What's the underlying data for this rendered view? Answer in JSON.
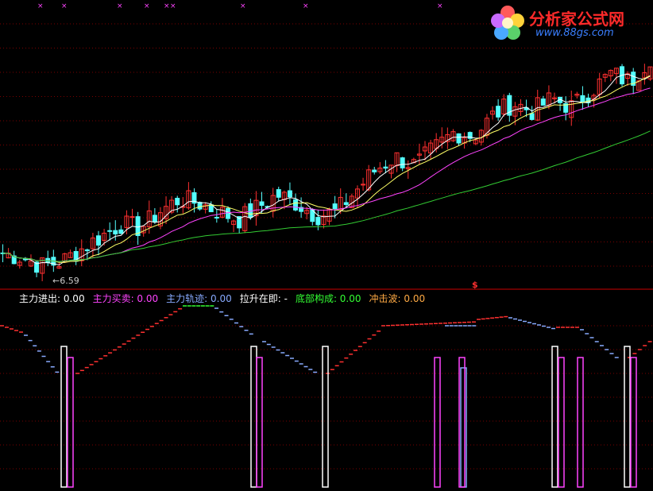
{
  "logo": {
    "title": "分析家公式网",
    "url": "www.88gs.com",
    "icon": "flower-logo-icon"
  },
  "colors": {
    "up": "#ff3030",
    "down": "#54ffff",
    "ma_fast": "#ffffff",
    "ma_mid": "#ffff66",
    "ma_slow": "#ff44ff",
    "ma_long": "#33cc33",
    "grid": "#7a0000",
    "divider": "#cc0000"
  },
  "price_panel": {
    "low_marker": "←6.59",
    "signal_mark": "$",
    "top_marks_icon": "x-mark-icon"
  },
  "legend": [
    {
      "label": "主力进出: 0.00",
      "color": "#ffffff"
    },
    {
      "label": "主力买卖: 0.00",
      "color": "#ff44ff"
    },
    {
      "label": "主力轨迹: 0.00",
      "color": "#88aaff"
    },
    {
      "label": "拉升在即: -",
      "color": "#ffffff"
    },
    {
      "label": "底部构成: 0.00",
      "color": "#33ff33"
    },
    {
      "label": "冲击波: 0.00",
      "color": "#ffaa44"
    }
  ],
  "chart_data": {
    "type": "candlestick",
    "low_price": 6.59,
    "ohlc_trend": [
      6.9,
      6.8,
      6.6,
      6.7,
      7.0,
      7.3,
      7.6,
      7.5,
      7.9,
      8.2,
      8.1,
      7.9,
      7.7,
      8.0,
      8.3,
      8.1,
      7.8,
      7.9,
      8.4,
      8.9,
      9.2,
      9.0,
      9.4,
      9.8,
      9.7,
      10.2,
      10.5,
      10.3,
      10.6,
      10.4,
      10.8,
      11.2,
      11.0,
      11.6
    ]
  }
}
